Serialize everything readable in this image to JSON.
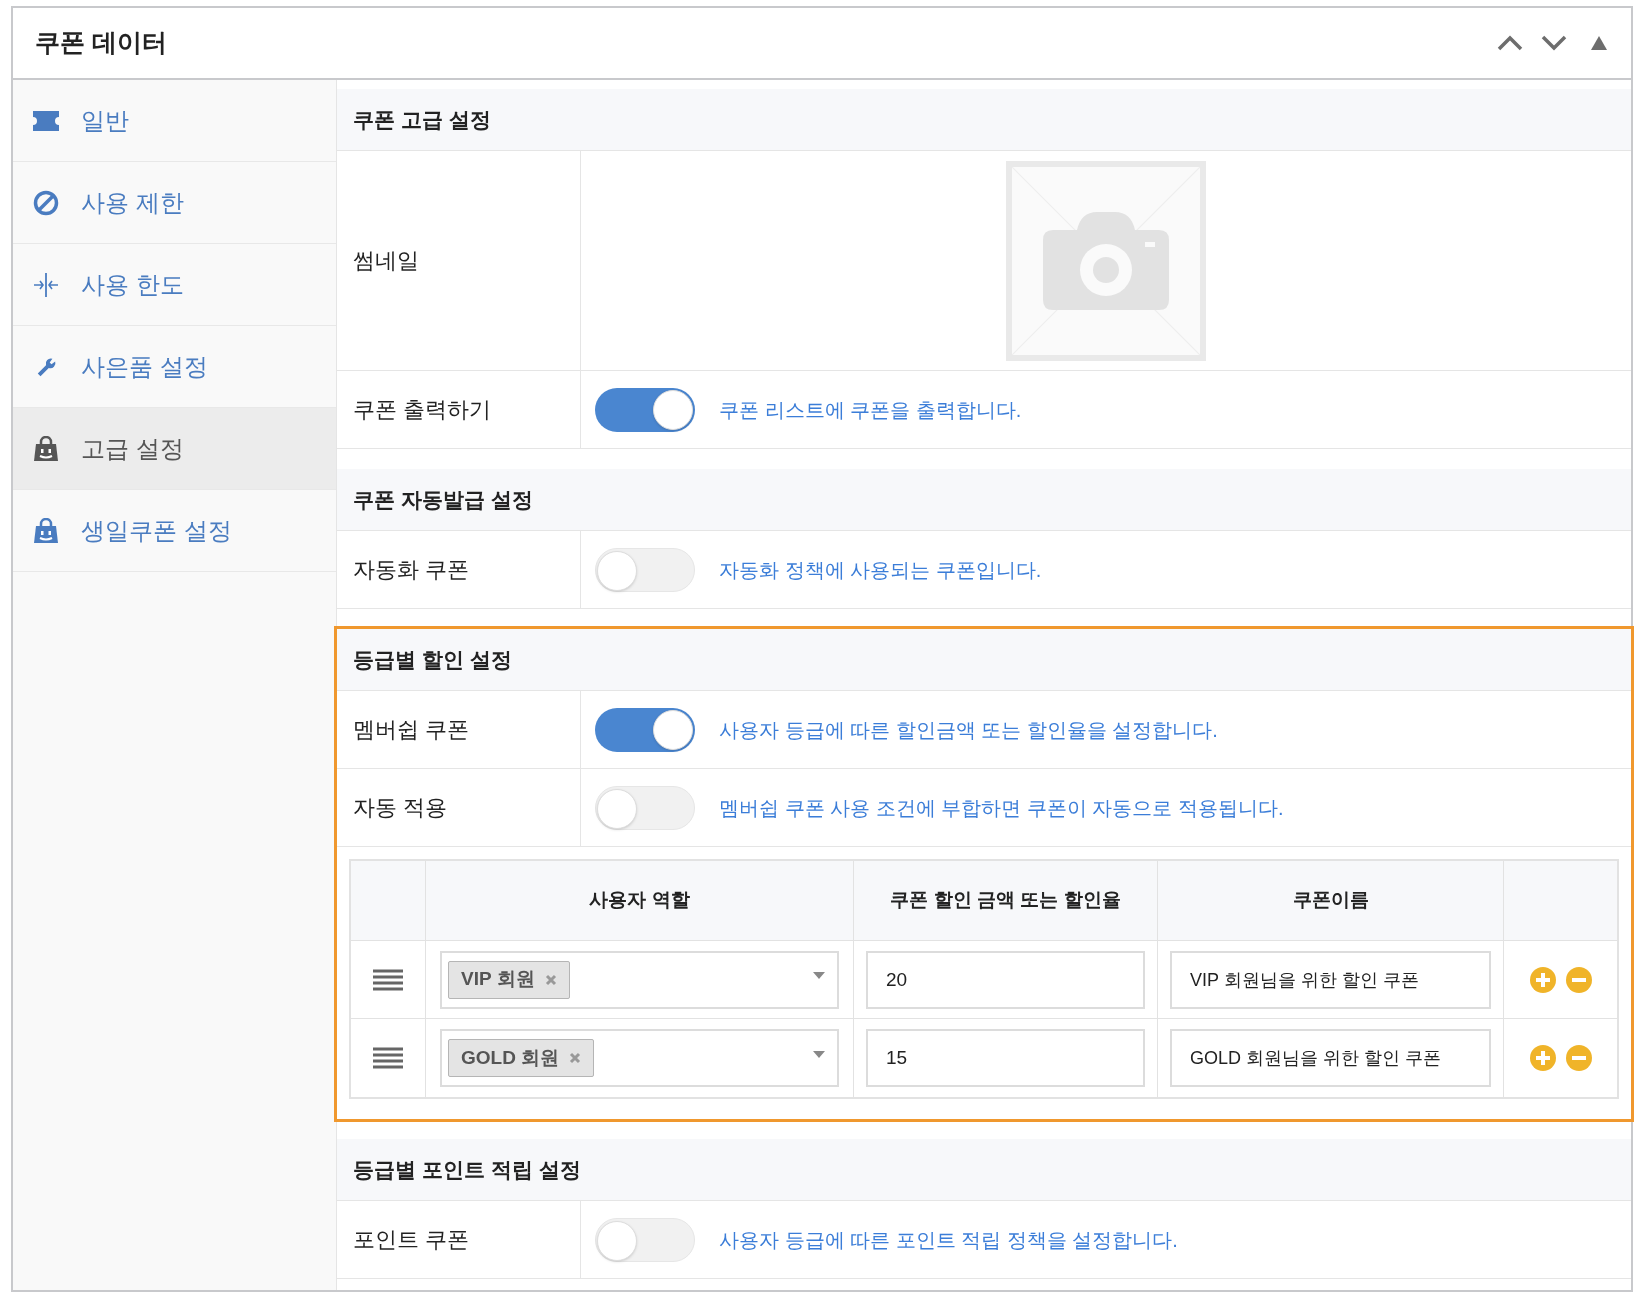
{
  "panel": {
    "title": "쿠폰 데이터"
  },
  "sidebar": {
    "items": [
      {
        "label": "일반",
        "selected": false
      },
      {
        "label": "사용 제한",
        "selected": false
      },
      {
        "label": "사용 한도",
        "selected": false
      },
      {
        "label": "사은품 설정",
        "selected": false
      },
      {
        "label": "고급 설정",
        "selected": true
      },
      {
        "label": "생일쿠폰 설정",
        "selected": false
      }
    ]
  },
  "sections": [
    {
      "title": "쿠폰 고급 설정",
      "highlighted": false,
      "rows": [
        {
          "kind": "thumbnail",
          "label": "썸네일"
        },
        {
          "kind": "toggle",
          "label": "쿠폰 출력하기",
          "on": true,
          "description": "쿠폰 리스트에 쿠폰을 출력합니다."
        }
      ]
    },
    {
      "title": "쿠폰 자동발급 설정",
      "highlighted": false,
      "rows": [
        {
          "kind": "toggle",
          "label": "자동화 쿠폰",
          "on": false,
          "description": "자동화 정책에 사용되는 쿠폰입니다."
        }
      ]
    },
    {
      "title": "등급별 할인 설정",
      "highlighted": true,
      "rows": [
        {
          "kind": "toggle",
          "label": "멤버쉽 쿠폰",
          "on": true,
          "description": "사용자 등급에 따른 할인금액 또는 할인율을 설정합니다."
        },
        {
          "kind": "toggle",
          "label": "자동 적용",
          "on": false,
          "description": "멤버쉽 쿠폰 사용 조건에 부합하면 쿠폰이 자동으로 적용됩니다."
        },
        {
          "kind": "table",
          "columns": [
            "사용자 역할",
            "쿠폰 할인 금액 또는 할인율",
            "쿠폰이름"
          ],
          "rows": [
            {
              "roles": [
                "VIP 회원"
              ],
              "amount": "20",
              "coupon_name": "VIP 회원님을 위한 할인 쿠폰"
            },
            {
              "roles": [
                "GOLD 회원"
              ],
              "amount": "15",
              "coupon_name": "GOLD 회원님을 위한 할인 쿠폰"
            }
          ]
        }
      ]
    },
    {
      "title": "등급별 포인트 적립 설정",
      "highlighted": false,
      "rows": [
        {
          "kind": "toggle",
          "label": "포인트 쿠폰",
          "on": false,
          "description": "사용자 등급에 따른 포인트 적립 정책을 설정합니다."
        }
      ]
    }
  ]
}
